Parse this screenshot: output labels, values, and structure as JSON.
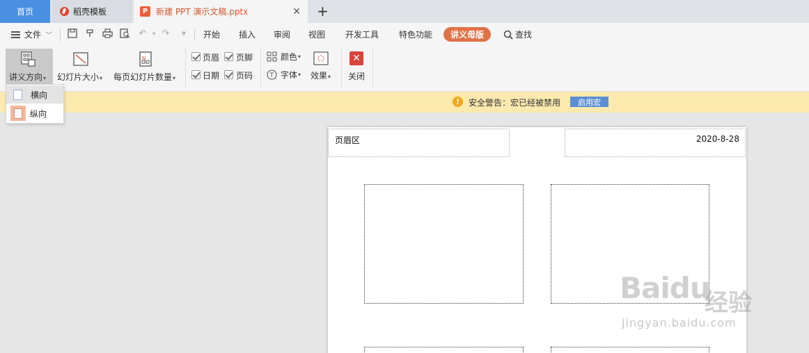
{
  "tabs": {
    "home": "首页",
    "template": "稻壳模板",
    "document": "新建 PPT 演示文稿.pptx",
    "add": "+"
  },
  "menu": {
    "file": "文件",
    "items": [
      "开始",
      "插入",
      "审阅",
      "视图",
      "开发工具",
      "特色功能"
    ],
    "active": "讲义母版",
    "search": "查找"
  },
  "ribbon": {
    "orientation": "讲义方向",
    "slide_size": "幻灯片大小",
    "per_page": "每页幻灯片数量",
    "header": "页眉",
    "footer": "页脚",
    "date": "日期",
    "page_number": "页码",
    "color": "颜色",
    "font": "字体",
    "effect": "效果",
    "close": "关闭"
  },
  "dropdown": {
    "landscape": "横向",
    "portrait": "纵向"
  },
  "security": {
    "message": "安全警告：宏已经被禁用",
    "button": "启用宏"
  },
  "page": {
    "header_area": "页眉区",
    "date": "2020-8-28"
  },
  "watermark": {
    "brand": "Baidu",
    "cn": "经验",
    "url": "jingyan.baidu.com"
  }
}
